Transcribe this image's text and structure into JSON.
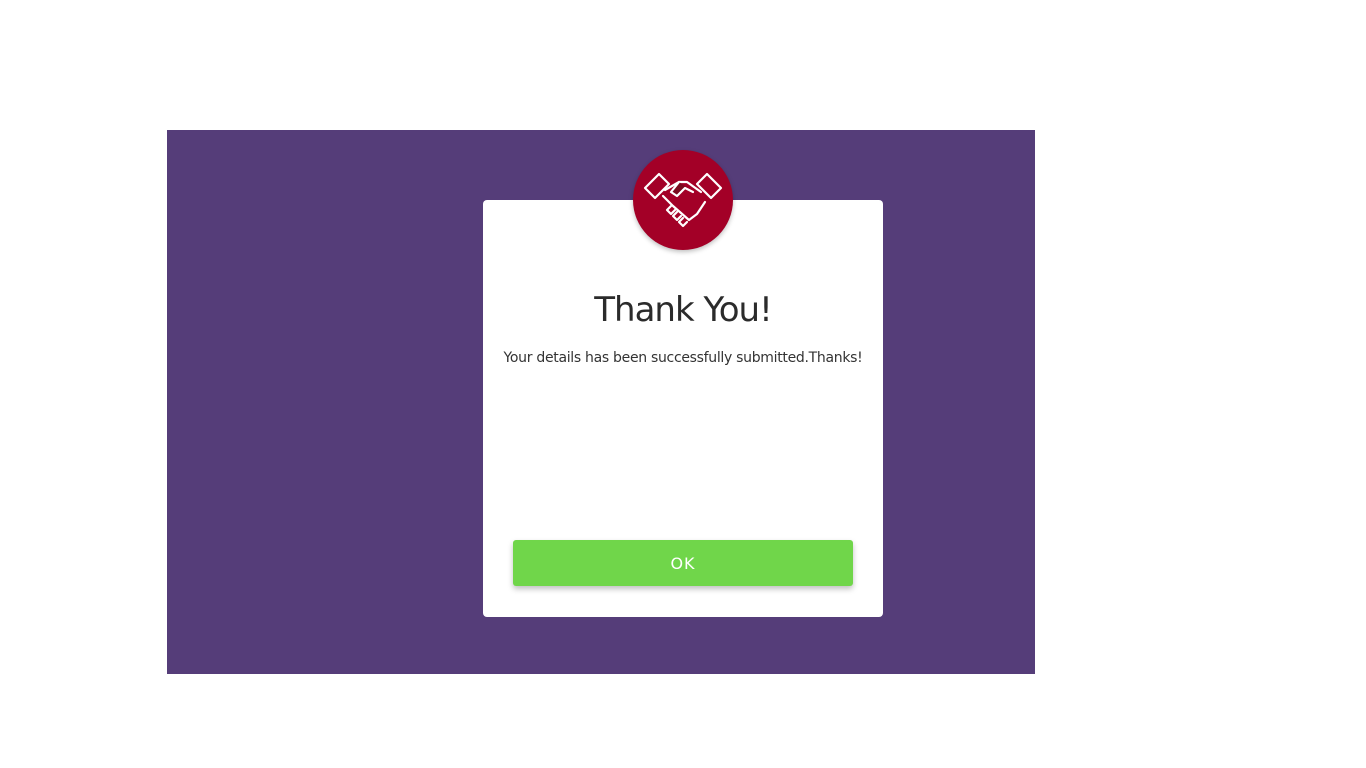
{
  "dialog": {
    "title": "Thank You!",
    "message": "Your details has been successfully submitted.Thanks!",
    "ok_label": "OK",
    "icon": "handshake-icon"
  },
  "colors": {
    "overlay": "#553d79",
    "badge": "#a30027",
    "button": "#70d64a",
    "title": "#2b2b2b"
  }
}
